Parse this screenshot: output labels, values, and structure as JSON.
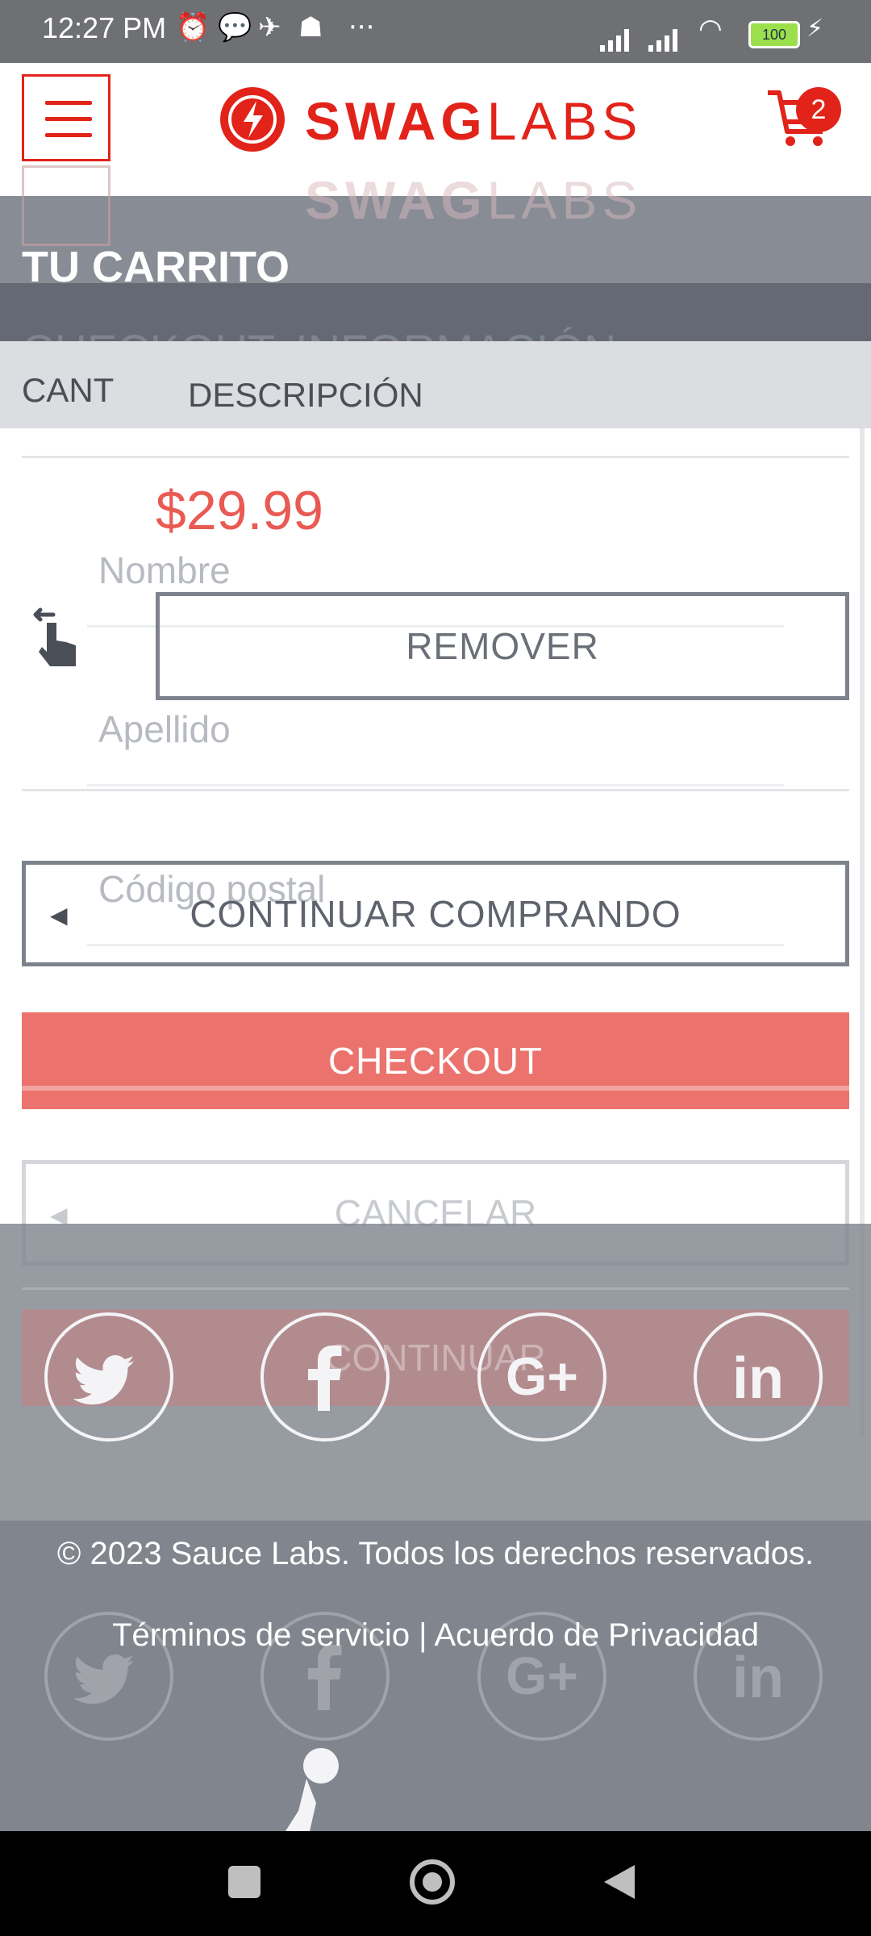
{
  "status_bar": {
    "time": "12:27 PM",
    "dots": "···",
    "battery": "100"
  },
  "header": {
    "logo_bold": "SWAG",
    "logo_light": "LABS",
    "cart_count": "2"
  },
  "cart": {
    "title": "TU CARRITO",
    "col_qty": "CANT",
    "col_desc": "DESCRIPCIÓN",
    "items": [
      {
        "price": "$29.99",
        "remove_label": "REMOVER"
      }
    ],
    "continue_label": "CONTINUAR COMPRANDO",
    "checkout_label": "CHECKOUT"
  },
  "ghost_checkout": {
    "title": "CHECKOUT: INFORMACIÓN",
    "first_name_placeholder": "Nombre",
    "last_name_placeholder": "Apellido",
    "postal_placeholder": "Código postal",
    "cancel_label": "CANCELAR",
    "continue_label": "CONTINUAR"
  },
  "footer": {
    "copyright": "© 2023 Sauce Labs. Todos los derechos reservados.",
    "legal": "Términos de servicio | Acuerdo de Privacidad",
    "social": [
      "twitter-icon",
      "facebook-icon",
      "google-plus-icon",
      "linkedin-icon"
    ]
  },
  "colors": {
    "brand_red": "#e2231a",
    "checkout_button": "#ec726e",
    "overlay_gray": "#80858e"
  }
}
